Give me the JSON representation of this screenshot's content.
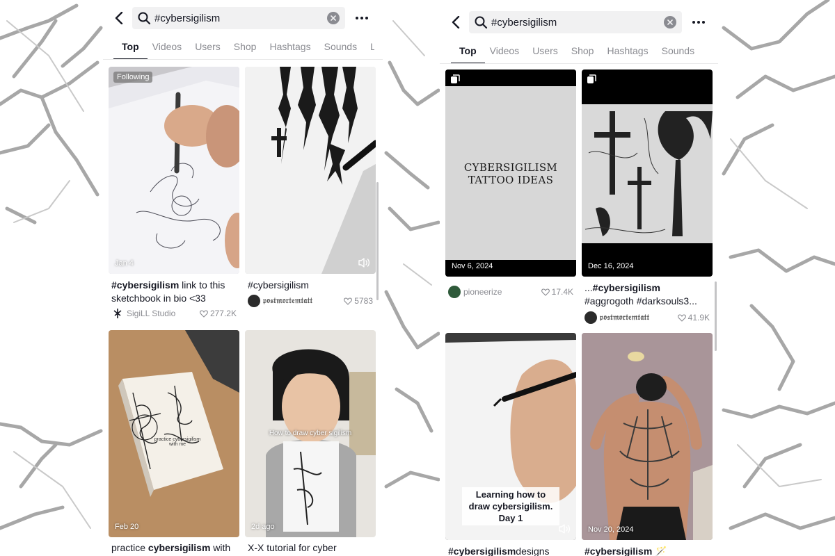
{
  "left": {
    "search": {
      "query": "#cybersigilism"
    },
    "tabs": [
      "Top",
      "Videos",
      "Users",
      "Shop",
      "Hashtags",
      "Sounds",
      "L"
    ],
    "cards": [
      {
        "badge": "Following",
        "date": "Jan 4",
        "desc_bold": "#cybersigilism",
        "desc_rest": " link to this sketchbook in bio <33",
        "author": "SigiLL Studio",
        "likes": "277.2K"
      },
      {
        "desc_bold": "",
        "desc_rest": "#cybersigilism",
        "author": "𝔭𝔬𝔰𝔱𝔪𝔬𝔯𝔱𝔢𝔪𝔱𝔞𝔱𝔱",
        "likes": "5783"
      },
      {
        "date": "Feb 20",
        "desc_pre": "practice ",
        "desc_bold": "cybersigilism",
        "desc_rest": " with",
        "book_text": "practice cybersigilism with me"
      },
      {
        "date": "2d ago",
        "overlay": "How to draw cyber sigilism",
        "desc_rest": "X-X tutorial for cyber"
      }
    ]
  },
  "right": {
    "search": {
      "query": "#cybersigilism"
    },
    "tabs": [
      "Top",
      "Videos",
      "Users",
      "Shop",
      "Hashtags",
      "Sounds"
    ],
    "cards": [
      {
        "date": "Nov 6, 2024",
        "poster_line1": "CYBERSIGILISM",
        "poster_line2": "TATTOO IDEAS",
        "author": "pioneerize",
        "likes": "17.4K"
      },
      {
        "date": "Dec 16, 2024",
        "desc_line1_pre": "...",
        "desc_line1_bold": "#cybersigilism",
        "desc_line2": "#aggrogoth #darksouls3...",
        "author": "𝔭𝔬𝔰𝔱𝔪𝔬𝔯𝔱𝔢𝔪𝔱𝔞𝔱𝔱",
        "likes": "41.9K"
      },
      {
        "caption": "Learning how to draw cybersigilism. Day 1",
        "desc_bold": "#cybersigilism",
        "desc_rest": "designs"
      },
      {
        "date": "Nov 20, 2024",
        "desc_bold": "#cybersigilism",
        "desc_rest": " 🪄"
      }
    ]
  }
}
